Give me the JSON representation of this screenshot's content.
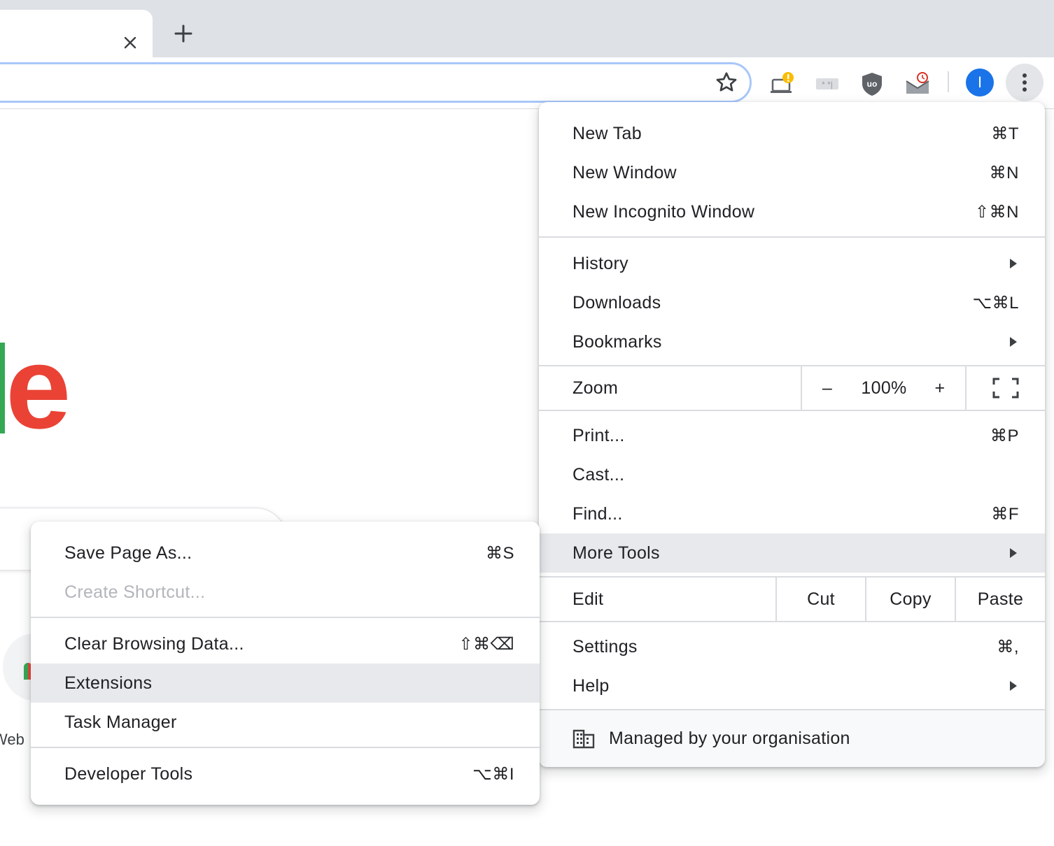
{
  "tab_strip": {
    "close_icon": "close-icon",
    "new_tab_icon": "plus-icon"
  },
  "toolbar": {
    "bookmark_icon": "star-icon",
    "extensions": [
      "cast-warning-icon",
      "password-extension-icon",
      "ublock-origin-icon",
      "mail-checker-icon"
    ],
    "avatar_letter": "I",
    "avatar_color": "#1a73e8",
    "menu_icon": "three-dots-icon"
  },
  "page": {
    "logo_letter": "e",
    "shortcut_label": "Web"
  },
  "main_menu": {
    "group1": [
      {
        "label": "New Tab",
        "shortcut": "⌘T"
      },
      {
        "label": "New Window",
        "shortcut": "⌘N"
      },
      {
        "label": "New Incognito Window",
        "shortcut": "⇧⌘N"
      }
    ],
    "group2": [
      {
        "label": "History",
        "submenu": true
      },
      {
        "label": "Downloads",
        "shortcut": "⌥⌘L"
      },
      {
        "label": "Bookmarks",
        "submenu": true
      }
    ],
    "zoom": {
      "label": "Zoom",
      "minus": "–",
      "level": "100%",
      "plus": "+",
      "fullscreen_icon": "fullscreen-icon"
    },
    "group3": [
      {
        "label": "Print...",
        "shortcut": "⌘P"
      },
      {
        "label": "Cast..."
      },
      {
        "label": "Find...",
        "shortcut": "⌘F"
      },
      {
        "label": "More Tools",
        "submenu": true,
        "highlighted": true
      }
    ],
    "edit": {
      "label": "Edit",
      "cut": "Cut",
      "copy": "Copy",
      "paste": "Paste"
    },
    "group4": [
      {
        "label": "Settings",
        "shortcut": "⌘,"
      },
      {
        "label": "Help",
        "submenu": true
      }
    ],
    "managed": {
      "icon": "building-icon",
      "label": "Managed by your organisation"
    }
  },
  "more_tools_menu": {
    "group1": [
      {
        "label": "Save Page As...",
        "shortcut": "⌘S"
      },
      {
        "label": "Create Shortcut...",
        "disabled": true
      }
    ],
    "group2": [
      {
        "label": "Clear Browsing Data...",
        "shortcut": "⇧⌘⌫"
      },
      {
        "label": "Extensions",
        "highlighted": true
      },
      {
        "label": "Task Manager"
      }
    ],
    "group3": [
      {
        "label": "Developer Tools",
        "shortcut": "⌥⌘I"
      }
    ]
  },
  "colors": {
    "highlight": "#e8e9ec",
    "disabled_text": "#b2b5ba",
    "logo_red": "#ea4335",
    "logo_green": "#34a853"
  }
}
